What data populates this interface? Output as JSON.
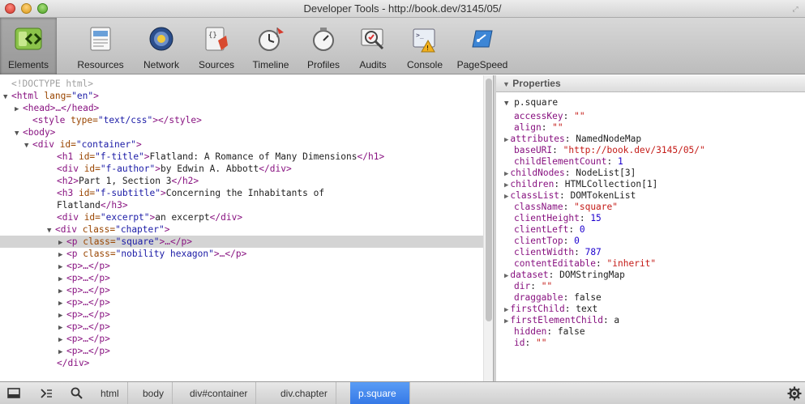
{
  "window": {
    "title": "Developer Tools - http://book.dev/3145/05/"
  },
  "toolbar": {
    "tabs": [
      {
        "label": "Elements",
        "icon": "elements-icon",
        "active": true
      },
      {
        "label": "Resources",
        "icon": "resources-icon"
      },
      {
        "label": "Network",
        "icon": "network-icon"
      },
      {
        "label": "Sources",
        "icon": "sources-icon"
      },
      {
        "label": "Timeline",
        "icon": "timeline-icon"
      },
      {
        "label": "Profiles",
        "icon": "profiles-icon"
      },
      {
        "label": "Audits",
        "icon": "audits-icon"
      },
      {
        "label": "Console",
        "icon": "console-icon"
      },
      {
        "label": "PageSpeed",
        "icon": "pagespeed-icon"
      }
    ]
  },
  "dom": {
    "doctype": "<!DOCTYPE html>",
    "html_open": {
      "tag": "<html",
      "attr": " lang=",
      "val": "\"en\"",
      "close": ">"
    },
    "head": "<head>…</head>",
    "style": {
      "open": "<style",
      "attr": " type=",
      "val": "\"text/css\"",
      "rest": "></style>"
    },
    "body": "<body>",
    "container": {
      "open": "<div",
      "attr": " id=",
      "val": "\"container\"",
      "close": ">"
    },
    "h1": {
      "open": "<h1",
      "attr": " id=",
      "val": "\"f-title\"",
      "close": ">",
      "text": "Flatland: A Romance of Many Dimensions",
      "end": "</h1>"
    },
    "author": {
      "open": "<div",
      "attr": " id=",
      "val": "\"f-author\"",
      "close": ">",
      "text": "by Edwin A. Abbott",
      "end": "</div>"
    },
    "h2": {
      "open": "<h2>",
      "text": "Part 1, Section 3",
      "end": "</h2>"
    },
    "h3": {
      "open": "<h3",
      "attr": " id=",
      "val": "\"f-subtitle\"",
      "close": ">",
      "text": "Concerning the Inhabitants of",
      "text2": "Flatland",
      "end": "</h3>"
    },
    "excerpt": {
      "open": "<div",
      "attr": " id=",
      "val": "\"excerpt\"",
      "close": ">",
      "text": "an excerpt",
      "end": "</div>"
    },
    "chapter": {
      "open": "<div",
      "attr": " class=",
      "val": "\"chapter\"",
      "close": ">"
    },
    "p_square": {
      "open": "<p",
      "attr": " class=",
      "val": "\"square\"",
      "rest": ">…</p>"
    },
    "p_nobility": {
      "open": "<p",
      "attr": " class=",
      "val": "\"nobility hexagon\"",
      "rest": ">…</p>"
    },
    "p_generic": "<p>…</p>",
    "div_close": "</div>"
  },
  "properties": {
    "header": "Properties",
    "object": "p.square",
    "items": [
      {
        "name": "accessKey",
        "sep": ": ",
        "value": "\"\"",
        "kind": "str",
        "expandable": false
      },
      {
        "name": "align",
        "sep": ": ",
        "value": "\"\"",
        "kind": "str",
        "expandable": false
      },
      {
        "name": "attributes",
        "sep": ": ",
        "value": "NamedNodeMap",
        "kind": "obj",
        "expandable": true
      },
      {
        "name": "baseURI",
        "sep": ": ",
        "value": "\"http://book.dev/3145/05/\"",
        "kind": "str",
        "expandable": false
      },
      {
        "name": "childElementCount",
        "sep": ": ",
        "value": "1",
        "kind": "num",
        "expandable": false
      },
      {
        "name": "childNodes",
        "sep": ": ",
        "value": "NodeList[3]",
        "kind": "obj",
        "expandable": true
      },
      {
        "name": "children",
        "sep": ": ",
        "value": "HTMLCollection[1]",
        "kind": "obj",
        "expandable": true
      },
      {
        "name": "classList",
        "sep": ": ",
        "value": "DOMTokenList",
        "kind": "obj",
        "expandable": true
      },
      {
        "name": "className",
        "sep": ": ",
        "value": "\"square\"",
        "kind": "str",
        "expandable": false
      },
      {
        "name": "clientHeight",
        "sep": ": ",
        "value": "15",
        "kind": "num",
        "expandable": false
      },
      {
        "name": "clientLeft",
        "sep": ": ",
        "value": "0",
        "kind": "num",
        "expandable": false
      },
      {
        "name": "clientTop",
        "sep": ": ",
        "value": "0",
        "kind": "num",
        "expandable": false
      },
      {
        "name": "clientWidth",
        "sep": ": ",
        "value": "787",
        "kind": "num",
        "expandable": false
      },
      {
        "name": "contentEditable",
        "sep": ": ",
        "value": "\"inherit\"",
        "kind": "str",
        "expandable": false
      },
      {
        "name": "dataset",
        "sep": ": ",
        "value": "DOMStringMap",
        "kind": "obj",
        "expandable": true
      },
      {
        "name": "dir",
        "sep": ": ",
        "value": "\"\"",
        "kind": "str",
        "expandable": false
      },
      {
        "name": "draggable",
        "sep": ": ",
        "value": "false",
        "kind": "obj",
        "expandable": false
      },
      {
        "name": "firstChild",
        "sep": ": ",
        "value": "text",
        "kind": "obj",
        "expandable": true
      },
      {
        "name": "firstElementChild",
        "sep": ": ",
        "value": "a",
        "kind": "obj",
        "expandable": true
      },
      {
        "name": "hidden",
        "sep": ": ",
        "value": "false",
        "kind": "obj",
        "expandable": false
      },
      {
        "name": "id",
        "sep": ": ",
        "value": "\"\"",
        "kind": "str",
        "expandable": false
      }
    ]
  },
  "breadcrumbs": [
    {
      "label": "html"
    },
    {
      "label": "body"
    },
    {
      "label": "div#container"
    },
    {
      "label": "div.chapter"
    },
    {
      "label": "p.square",
      "active": true
    }
  ],
  "colors": {
    "accent": "#3478e6",
    "tag": "#881280",
    "attr_value": "#1a1aa6"
  }
}
